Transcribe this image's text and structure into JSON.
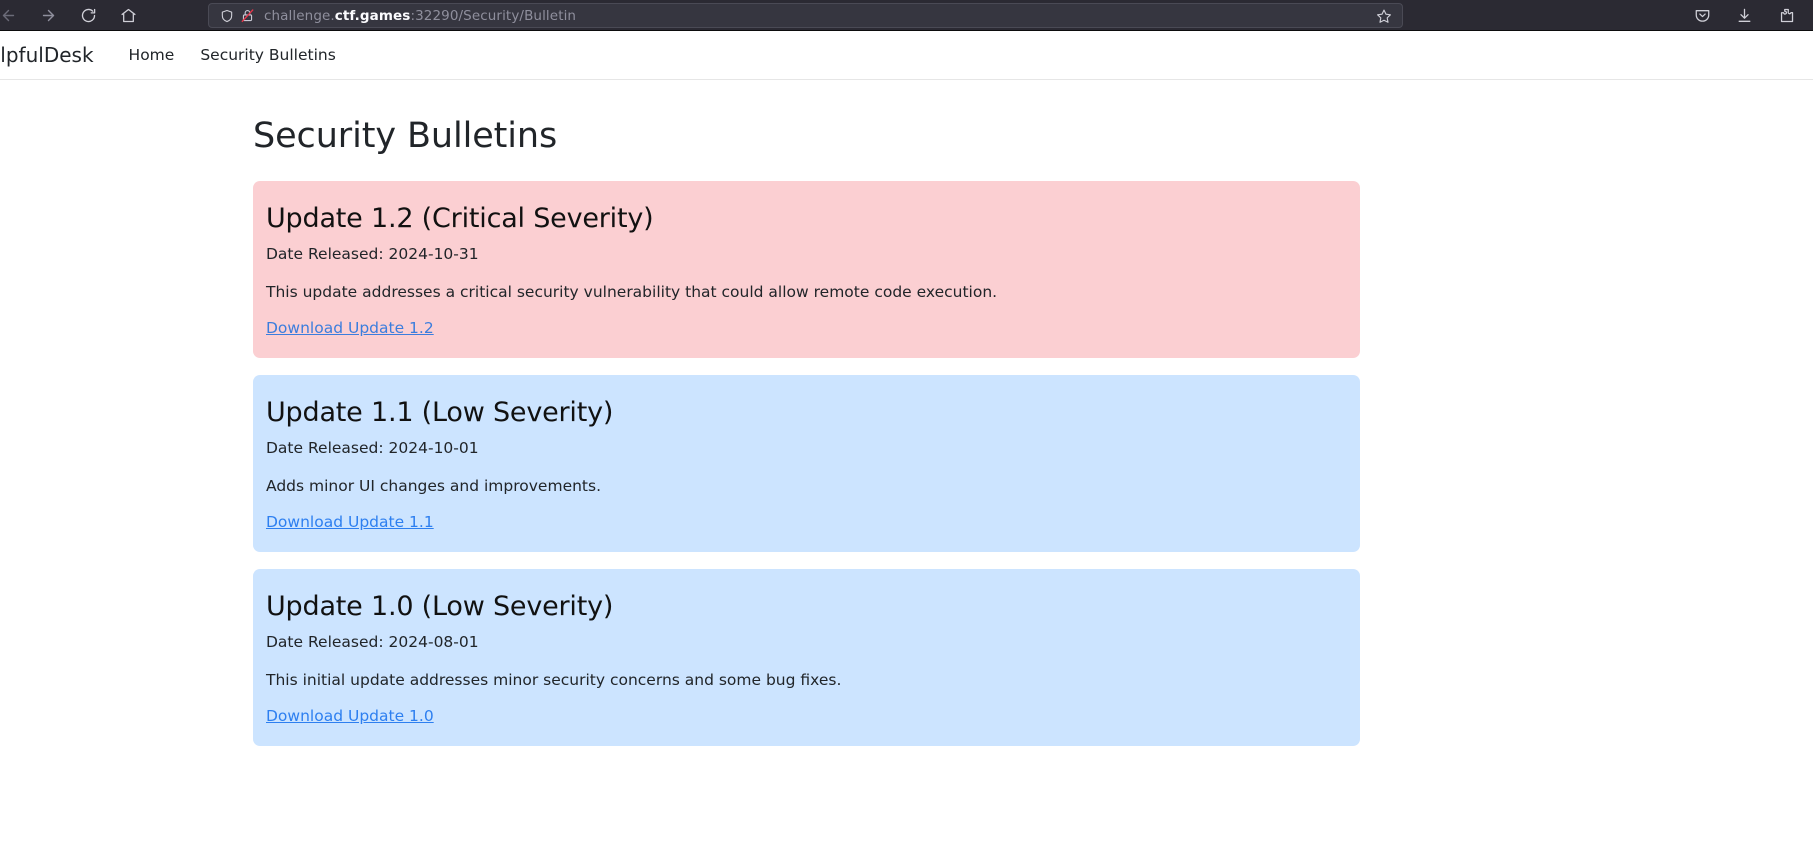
{
  "browser": {
    "back_icon": "back-arrow-icon",
    "forward_icon": "forward-arrow-icon",
    "reload_icon": "reload-icon",
    "home_icon": "home-icon",
    "shield_icon": "shield-icon",
    "insecure_lock_icon": "lock-crossed-out-icon",
    "bookmark_icon": "star-icon",
    "pocket_icon": "pocket-save-icon",
    "downloads_icon": "download-arrow-icon",
    "extensions_icon": "extensions-puzzle-icon",
    "url_prefix": "challenge.",
    "url_host": "ctf.games",
    "url_suffix": ":32290/Security/Bulletin",
    "url_full": "challenge.ctf.games:32290/Security/Bulletin"
  },
  "site_nav": {
    "brand": "elpfulDesk",
    "links": [
      {
        "label": "Home"
      },
      {
        "label": "Security Bulletins"
      }
    ]
  },
  "page": {
    "title": "Security Bulletins"
  },
  "bulletins": [
    {
      "title": "Update 1.2 (Critical Severity)",
      "date": "Date Released: 2024-10-31",
      "description": "This update addresses a critical security vulnerability that could allow remote code execution.",
      "link_label": "Download Update 1.2",
      "severity": "critical",
      "background_color": "#fbcfd2"
    },
    {
      "title": "Update 1.1 (Low Severity)",
      "date": "Date Released: 2024-10-01",
      "description": "Adds minor UI changes and improvements.",
      "link_label": "Download Update 1.1",
      "severity": "low",
      "background_color": "#cce4ff"
    },
    {
      "title": "Update 1.0 (Low Severity)",
      "date": "Date Released: 2024-08-01",
      "description": "This initial update addresses minor security concerns and some bug fixes.",
      "link_label": "Download Update 1.0",
      "severity": "low",
      "background_color": "#cce4ff"
    }
  ]
}
